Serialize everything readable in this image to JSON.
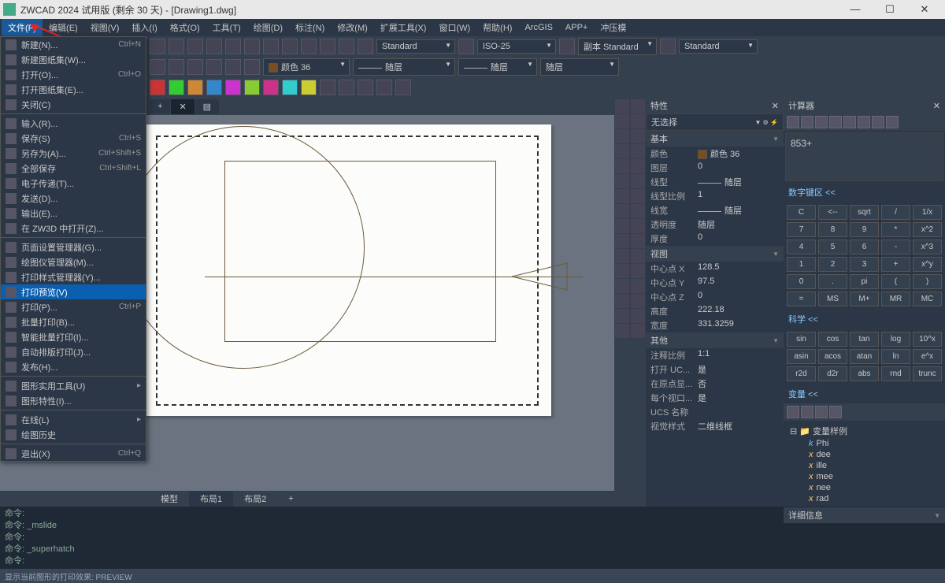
{
  "title": "ZWCAD 2024 试用版 (剩余 30 天) - [Drawing1.dwg]",
  "menubar": [
    "文件(F)",
    "编辑(E)",
    "视图(V)",
    "插入(I)",
    "格式(O)",
    "工具(T)",
    "绘图(D)",
    "标注(N)",
    "修改(M)",
    "扩展工具(X)",
    "窗口(W)",
    "帮助(H)",
    "ArcGIS",
    "APP+",
    "冲压模"
  ],
  "file_menu": {
    "group1": [
      {
        "label": "新建(N)...",
        "shortcut": "Ctrl+N"
      },
      {
        "label": "新建图纸集(W)...",
        "shortcut": ""
      },
      {
        "label": "打开(O)...",
        "shortcut": "Ctrl+O"
      },
      {
        "label": "打开图纸集(E)...",
        "shortcut": ""
      },
      {
        "label": "关闭(C)",
        "shortcut": ""
      }
    ],
    "group2": [
      {
        "label": "输入(R)...",
        "shortcut": ""
      },
      {
        "label": "保存(S)",
        "shortcut": "Ctrl+S"
      },
      {
        "label": "另存为(A)...",
        "shortcut": "Ctrl+Shift+S"
      },
      {
        "label": "全部保存",
        "shortcut": "Ctrl+Shift+L"
      },
      {
        "label": "电子传递(T)...",
        "shortcut": ""
      },
      {
        "label": "发送(D)...",
        "shortcut": ""
      },
      {
        "label": "输出(E)...",
        "shortcut": ""
      },
      {
        "label": "在 ZW3D 中打开(Z)...",
        "shortcut": ""
      }
    ],
    "group3": [
      {
        "label": "页面设置管理器(G)...",
        "shortcut": ""
      },
      {
        "label": "绘图仪管理器(M)...",
        "shortcut": ""
      },
      {
        "label": "打印样式管理器(Y)...",
        "shortcut": ""
      },
      {
        "label": "打印预览(V)",
        "shortcut": "",
        "highlight": true
      },
      {
        "label": "打印(P)...",
        "shortcut": "Ctrl+P"
      },
      {
        "label": "批量打印(B)...",
        "shortcut": ""
      },
      {
        "label": "智能批量打印(I)...",
        "shortcut": ""
      },
      {
        "label": "自动排版打印(J)...",
        "shortcut": ""
      },
      {
        "label": "发布(H)...",
        "shortcut": ""
      }
    ],
    "group4": [
      {
        "label": "图形实用工具(U)",
        "shortcut": "",
        "arrow": true
      },
      {
        "label": "图形特性(I)...",
        "shortcut": ""
      }
    ],
    "group5": [
      {
        "label": "在线(L)",
        "shortcut": "",
        "arrow": true
      },
      {
        "label": "绘图历史",
        "shortcut": ""
      }
    ],
    "group6": [
      {
        "label": "退出(X)",
        "shortcut": "Ctrl+Q"
      }
    ]
  },
  "toolbar2": {
    "color": "颜色 36",
    "layer": "随层",
    "linetype": "随层",
    "lineweight": "随层",
    "textstyle": "Standard",
    "dimstyle": "ISO-25",
    "copy_std": "副本 Standard",
    "std2": "Standard"
  },
  "layout_tabs": [
    "模型",
    "布局1",
    "布局2"
  ],
  "active_layout": 1,
  "cmd_lines": [
    "命令:",
    "命令: _mslide",
    "命令:",
    "命令: _superhatch",
    "命令:"
  ],
  "status": "显示当前图形的打印效果: PREVIEW",
  "properties": {
    "title": "特性",
    "no_sel": "无选择",
    "sections": {
      "basic": {
        "title": "基本",
        "rows": [
          {
            "label": "颜色",
            "value": "颜色 36",
            "swatch": true
          },
          {
            "label": "图层",
            "value": "0"
          },
          {
            "label": "线型",
            "value": "随层",
            "line": true
          },
          {
            "label": "线型比例",
            "value": "1"
          },
          {
            "label": "线宽",
            "value": "随层",
            "line": true
          },
          {
            "label": "透明度",
            "value": "随层"
          },
          {
            "label": "厚度",
            "value": "0"
          }
        ]
      },
      "view": {
        "title": "视图",
        "rows": [
          {
            "label": "中心点 X",
            "value": "128.5"
          },
          {
            "label": "中心点 Y",
            "value": "97.5"
          },
          {
            "label": "中心点 Z",
            "value": "0"
          },
          {
            "label": "高度",
            "value": "222.18"
          },
          {
            "label": "宽度",
            "value": "331.3259"
          }
        ]
      },
      "other": {
        "title": "其他",
        "rows": [
          {
            "label": "注释比例",
            "value": "1:1"
          },
          {
            "label": "打开 UC...",
            "value": "是"
          },
          {
            "label": "在原点显...",
            "value": "否"
          },
          {
            "label": "每个视口...",
            "value": "是"
          },
          {
            "label": "UCS 名称",
            "value": ""
          },
          {
            "label": "视觉样式",
            "value": "二维线框"
          }
        ]
      }
    }
  },
  "calculator": {
    "title": "计算器",
    "display": "853+",
    "numpad_title": "数字键区",
    "sci_title": "科学",
    "numpad": [
      [
        "C",
        "<--",
        "sqrt",
        "/",
        "1/x"
      ],
      [
        "7",
        "8",
        "9",
        "*",
        "x^2"
      ],
      [
        "4",
        "5",
        "6",
        "-",
        "x^3"
      ],
      [
        "1",
        "2",
        "3",
        "+",
        "x^y"
      ],
      [
        "0",
        ".",
        "pi",
        "(",
        ")"
      ],
      [
        "=",
        "MS",
        "M+",
        "MR",
        "MC"
      ]
    ],
    "sci": [
      [
        "sin",
        "cos",
        "tan",
        "log",
        "10^x"
      ],
      [
        "asin",
        "acos",
        "atan",
        "ln",
        "e^x"
      ],
      [
        "r2d",
        "d2r",
        "abs",
        "rnd",
        "trunc"
      ]
    ],
    "vars_title": "变量",
    "vars_root": "变量样例",
    "vars": [
      {
        "t": "k",
        "n": "Phi"
      },
      {
        "t": "x",
        "n": "dee"
      },
      {
        "t": "x",
        "n": "ille"
      },
      {
        "t": "x",
        "n": "mee"
      },
      {
        "t": "x",
        "n": "nee"
      },
      {
        "t": "x",
        "n": "rad"
      }
    ],
    "detail": "详细信息"
  }
}
